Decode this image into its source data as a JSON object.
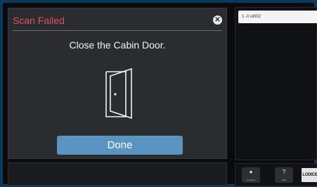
{
  "dialog": {
    "title": "Scan Failed",
    "close_icon": "close-icon",
    "message": "Close the Cabin Door.",
    "door_icon": "open-door-icon",
    "done_label": "Done"
  },
  "right_panel": {
    "items": [
      {
        "label": "1 -0 ut002"
      }
    ]
  },
  "toolbar": {
    "computer_icon": "computer-icon",
    "computer_label": "Computer",
    "help_icon": "help-icon",
    "help_label": "Help",
    "logo_text": "LODICE"
  },
  "colors": {
    "title_red": "#d9535f",
    "done_blue": "#5a95c2",
    "background_blue": "#0d3a5c"
  }
}
